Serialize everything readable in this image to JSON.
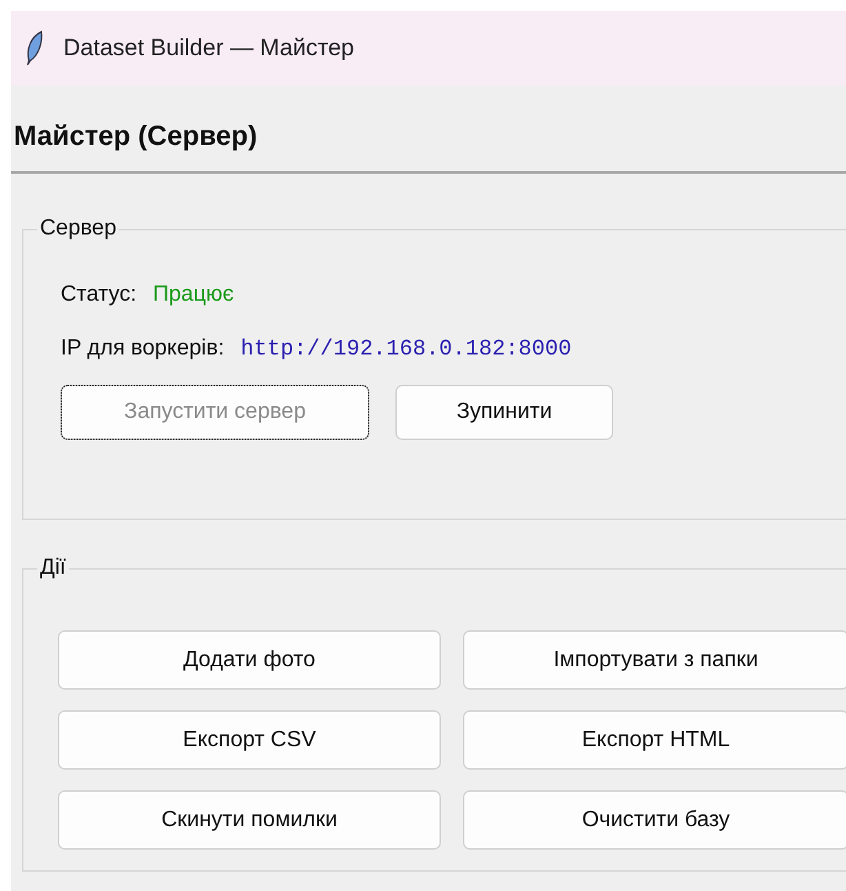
{
  "window": {
    "title": "Dataset Builder — Майстер"
  },
  "heading": "Майстер (Сервер)",
  "server_group": {
    "title": "Сервер",
    "status_label": "Статус:",
    "status_value": "Працює",
    "ip_label": "IP для воркерів:",
    "ip_value": "http://192.168.0.182:8000",
    "buttons": [
      {
        "label": "Запустити сервер",
        "disabled": true,
        "focused": true
      },
      {
        "label": "Зупинити",
        "disabled": false,
        "focused": false
      }
    ]
  },
  "actions_group": {
    "title": "Дії",
    "buttons": [
      "Додати фото",
      "Імпортувати з папки",
      "Експорт CSV",
      "Експорт HTML",
      "Скинути помилки",
      "Очистити базу"
    ]
  }
}
